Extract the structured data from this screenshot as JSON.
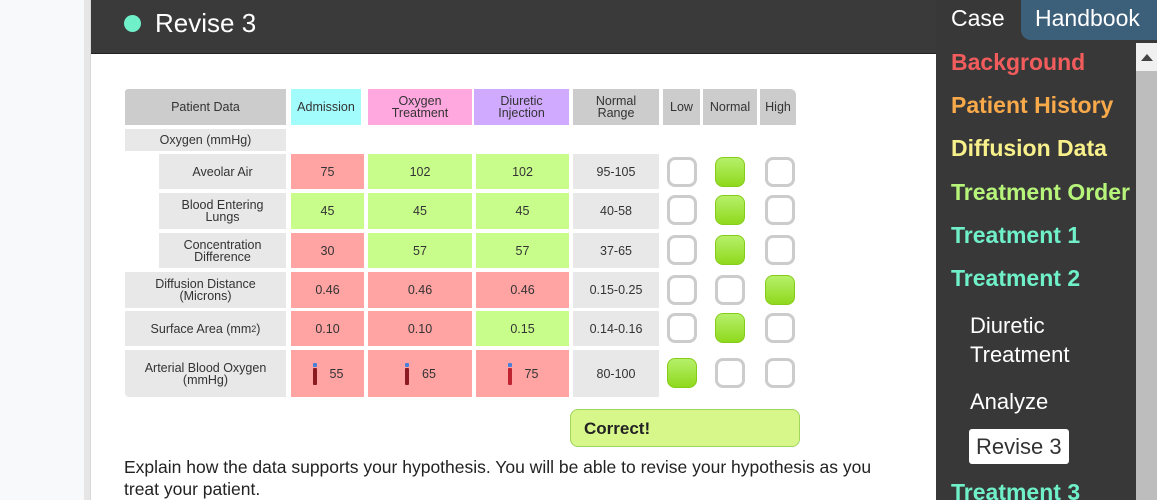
{
  "header": {
    "title": "Revise 3",
    "status_dot_color": "#6ff0c8"
  },
  "table": {
    "headers": {
      "patient_data": "Patient Data",
      "admission": "Admission",
      "oxygen_treatment": "Oxygen Treatment",
      "diuretic_injection": "Diuretic Injection",
      "normal_range": "Normal Range",
      "low": "Low",
      "normal": "Normal",
      "high": "High"
    },
    "header_colors": {
      "admission": "#a3fcfc",
      "oxygen_treatment": "#ffa8df",
      "diuretic_injection": "#d0aaff"
    },
    "group_label": "Oxygen (mmHg)",
    "rows": [
      {
        "label": "Aveolar Air",
        "admission": "75",
        "oxygen": "102",
        "diuretic": "102",
        "range": "95-105",
        "status": "normal",
        "colors": [
          "red",
          "green",
          "green"
        ]
      },
      {
        "label": "Blood Entering Lungs",
        "admission": "45",
        "oxygen": "45",
        "diuretic": "45",
        "range": "40-58",
        "status": "normal",
        "colors": [
          "green",
          "green",
          "green"
        ]
      },
      {
        "label": "Concentration Difference",
        "admission": "30",
        "oxygen": "57",
        "diuretic": "57",
        "range": "37-65",
        "status": "normal",
        "colors": [
          "red",
          "green",
          "green"
        ]
      },
      {
        "label": "Diffusion Distance (Microns)",
        "admission": "0.46",
        "oxygen": "0.46",
        "diuretic": "0.46",
        "range": "0.15-0.25",
        "status": "high",
        "colors": [
          "red",
          "red",
          "red"
        ]
      },
      {
        "label": "Surface Area (mm",
        "label_sup": "2",
        "label_end": ")",
        "admission": "0.10",
        "oxygen": "0.10",
        "diuretic": "0.15",
        "range": "0.14-0.16",
        "status": "normal",
        "colors": [
          "red",
          "red",
          "green"
        ]
      },
      {
        "label": "Arterial Blood Oxygen (mmHg)",
        "admission": "55",
        "oxygen": "65",
        "diuretic": "75",
        "range": "80-100",
        "status": "low",
        "colors": [
          "red",
          "red",
          "red"
        ],
        "icon": "blood-tube-icon"
      }
    ]
  },
  "feedback": {
    "text": "Correct!"
  },
  "prompt": {
    "text": "Explain how the data supports your hypothesis. You will be able to revise your hypothesis as you treat your patient."
  },
  "sidebar": {
    "tabs": [
      {
        "label": "Case",
        "active": true
      },
      {
        "label": "Handbook",
        "active": false
      }
    ],
    "items": [
      {
        "label": "Background",
        "color": "#f25c5c"
      },
      {
        "label": "Patient History",
        "color": "#f8a94a"
      },
      {
        "label": "Diffusion Data",
        "color": "#f8f08a"
      },
      {
        "label": "Treatment Order",
        "color": "#b6f47a"
      },
      {
        "label": "Treatment 1",
        "color": "#6ff0c8"
      },
      {
        "label": "Treatment 2",
        "color": "#6ff0c8"
      }
    ],
    "subitems": [
      {
        "label": "Diuretic Treatment"
      },
      {
        "label": "Analyze"
      },
      {
        "label": "Revise 3",
        "active": true
      }
    ],
    "after": {
      "label": "Treatment 3",
      "color": "#6ff0c8"
    }
  }
}
